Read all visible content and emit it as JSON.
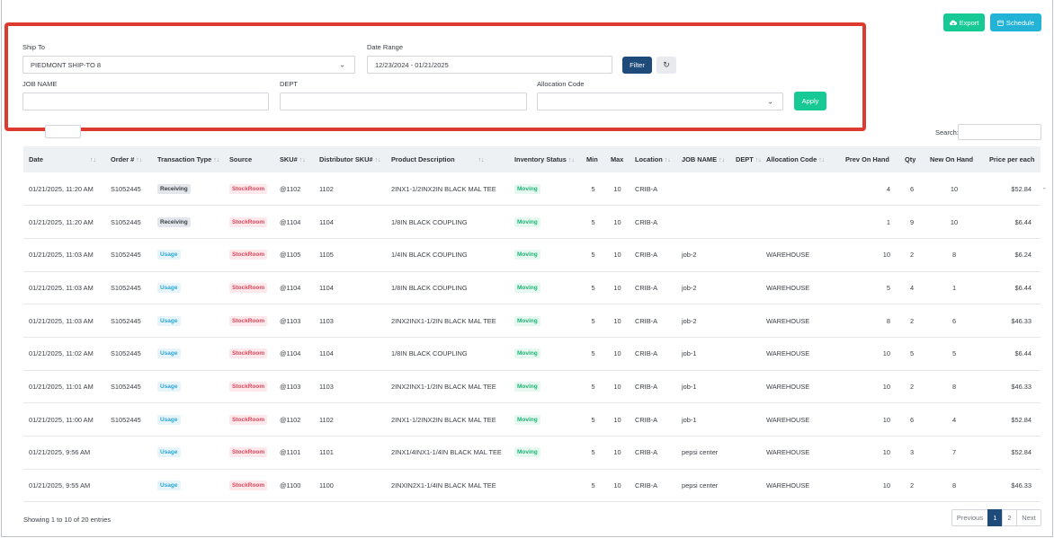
{
  "actions": {
    "export_label": "Export",
    "schedule_label": "Schedule"
  },
  "filters": {
    "ship_to_label": "Ship To",
    "ship_to_value": "PIEDMONT SHIP-TO 8",
    "date_range_label": "Date Range",
    "date_range_value": "12/23/2024 - 01/21/2025",
    "filter_label": "Filter",
    "reset_symbol": "↻",
    "job_name_label": "JOB NAME",
    "job_name_value": "",
    "dept_label": "DEPT",
    "dept_value": "",
    "allocation_label": "Allocation Code",
    "allocation_value": "",
    "apply_label": "Apply"
  },
  "search_label": "Search:",
  "table": {
    "columns": [
      "Date",
      "Order #",
      "Transaction Type",
      "Source",
      "SKU#",
      "Distributor SKU#",
      "Product Description",
      "Inventory Status",
      "Min",
      "Max",
      "Location",
      "JOB NAME",
      "DEPT",
      "Allocation Code",
      "Prev On Hand",
      "Qty",
      "New On Hand",
      "Price per each"
    ],
    "rows": [
      {
        "date": "01/21/2025, 11:20 AM",
        "order": "S1052445",
        "type": "Receiving",
        "source": "StockRoom",
        "sku": "@1102",
        "dist_sku": "1102",
        "desc": "2INX1-1/2INX2IN BLACK MAL TEE",
        "status": "Moving",
        "min": "5",
        "max": "10",
        "location": "CRIB-A",
        "job": "",
        "dept": "",
        "alloc": "",
        "prev": "4",
        "qty": "6",
        "new": "10",
        "price": "$52.84"
      },
      {
        "date": "01/21/2025, 11:20 AM",
        "order": "S1052445",
        "type": "Receiving",
        "source": "StockRoom",
        "sku": "@1104",
        "dist_sku": "1104",
        "desc": "1/8IN BLACK COUPLING",
        "status": "Moving",
        "min": "5",
        "max": "10",
        "location": "CRIB-A",
        "job": "",
        "dept": "",
        "alloc": "",
        "prev": "1",
        "qty": "9",
        "new": "10",
        "price": "$6.44"
      },
      {
        "date": "01/21/2025, 11:03 AM",
        "order": "S1052445",
        "type": "Usage",
        "source": "StockRoom",
        "sku": "@1105",
        "dist_sku": "1105",
        "desc": "1/4IN BLACK COUPLING",
        "status": "Moving",
        "min": "5",
        "max": "10",
        "location": "CRIB-A",
        "job": "job-2",
        "dept": "",
        "alloc": "WAREHOUSE",
        "prev": "10",
        "qty": "2",
        "new": "8",
        "price": "$6.24"
      },
      {
        "date": "01/21/2025, 11:03 AM",
        "order": "S1052445",
        "type": "Usage",
        "source": "StockRoom",
        "sku": "@1104",
        "dist_sku": "1104",
        "desc": "1/8IN BLACK COUPLING",
        "status": "Moving",
        "min": "5",
        "max": "10",
        "location": "CRIB-A",
        "job": "job-2",
        "dept": "",
        "alloc": "WAREHOUSE",
        "prev": "5",
        "qty": "4",
        "new": "1",
        "price": "$6.44"
      },
      {
        "date": "01/21/2025, 11:03 AM",
        "order": "S1052445",
        "type": "Usage",
        "source": "StockRoom",
        "sku": "@1103",
        "dist_sku": "1103",
        "desc": "2INX2INX1-1/2IN BLACK MAL TEE",
        "status": "Moving",
        "min": "5",
        "max": "10",
        "location": "CRIB-A",
        "job": "job-2",
        "dept": "",
        "alloc": "WAREHOUSE",
        "prev": "8",
        "qty": "2",
        "new": "6",
        "price": "$46.33"
      },
      {
        "date": "01/21/2025, 11:02 AM",
        "order": "S1052445",
        "type": "Usage",
        "source": "StockRoom",
        "sku": "@1104",
        "dist_sku": "1104",
        "desc": "1/8IN BLACK COUPLING",
        "status": "Moving",
        "min": "5",
        "max": "10",
        "location": "CRIB-A",
        "job": "job-1",
        "dept": "",
        "alloc": "WAREHOUSE",
        "prev": "10",
        "qty": "5",
        "new": "5",
        "price": "$6.44"
      },
      {
        "date": "01/21/2025, 11:01 AM",
        "order": "S1052445",
        "type": "Usage",
        "source": "StockRoom",
        "sku": "@1103",
        "dist_sku": "1103",
        "desc": "2INX2INX1-1/2IN BLACK MAL TEE",
        "status": "Moving",
        "min": "5",
        "max": "10",
        "location": "CRIB-A",
        "job": "job-1",
        "dept": "",
        "alloc": "WAREHOUSE",
        "prev": "10",
        "qty": "2",
        "new": "8",
        "price": "$46.33"
      },
      {
        "date": "01/21/2025, 11:00 AM",
        "order": "S1052445",
        "type": "Usage",
        "source": "StockRoom",
        "sku": "@1102",
        "dist_sku": "1102",
        "desc": "2INX1-1/2INX2IN BLACK MAL TEE",
        "status": "Moving",
        "min": "5",
        "max": "10",
        "location": "CRIB-A",
        "job": "job-1",
        "dept": "",
        "alloc": "WAREHOUSE",
        "prev": "10",
        "qty": "6",
        "new": "4",
        "price": "$52.84"
      },
      {
        "date": "01/21/2025, 9:56 AM",
        "order": "",
        "type": "Usage",
        "source": "StockRoom",
        "sku": "@1101",
        "dist_sku": "1101",
        "desc": "2INX1/4INX1-1/4IN BLACK MAL TEE",
        "status": "Moving",
        "min": "5",
        "max": "10",
        "location": "CRIB-A",
        "job": "pepsi center",
        "dept": "",
        "alloc": "WAREHOUSE",
        "prev": "10",
        "qty": "3",
        "new": "7",
        "price": "$52.84"
      },
      {
        "date": "01/21/2025, 9:55 AM",
        "order": "",
        "type": "Usage",
        "source": "StockRoom",
        "sku": "@1100",
        "dist_sku": "1100",
        "desc": "2INXIN2X1-1/4IN BLACK MAL TEE",
        "status": "",
        "min": "5",
        "max": "10",
        "location": "CRIB-A",
        "job": "pepsi center",
        "dept": "",
        "alloc": "WAREHOUSE",
        "prev": "10",
        "qty": "2",
        "new": "8",
        "price": "$46.33"
      }
    ]
  },
  "footer": {
    "showing_text": "Showing 1 to 10 of 20 entries"
  },
  "pagination": {
    "previous": "Previous",
    "page1": "1",
    "page2": "2",
    "next": "Next"
  }
}
